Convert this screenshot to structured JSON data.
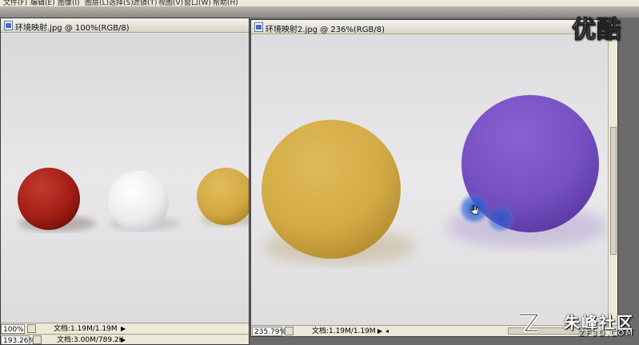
{
  "menu": {
    "items": [
      "文件(F)",
      "编辑(E)",
      "图像(I)",
      "图层(L)",
      "选择(S)",
      "滤镜(T)",
      "视图(V)",
      "窗口(W)",
      "帮助(H)"
    ]
  },
  "windows": {
    "left": {
      "title": "环境映射.jpg @ 100%(RGB/8)",
      "zoom": "100%",
      "doc_info": "文档:1.19M/1.19M",
      "zoom_bottom": "193.26%",
      "doc_info_bottom": "文档:3.00M/789.2K"
    },
    "right": {
      "title": "环境映射2.jpg @ 236%(RGB/8)",
      "zoom": "235.79%",
      "doc_info": "文档:1.19M/1.19M"
    }
  },
  "watermark": {
    "logo": "优酷",
    "site_name": "朱峰社区",
    "site_url": "ZF3D.COM"
  },
  "colors": {
    "red_ball": "#a8221a",
    "white_ball": "#ecebed",
    "yellow_ball": "#d5ad4a",
    "purple_ball": "#7a52c6",
    "background": "#e4e3e5",
    "cursor_blue": "#2f6bd8"
  },
  "icons": {
    "doc_icon": "photoshop-doc-icon",
    "status_menu": "arrow-right-icon",
    "hand_cursor": "hand-cursor-icon"
  }
}
